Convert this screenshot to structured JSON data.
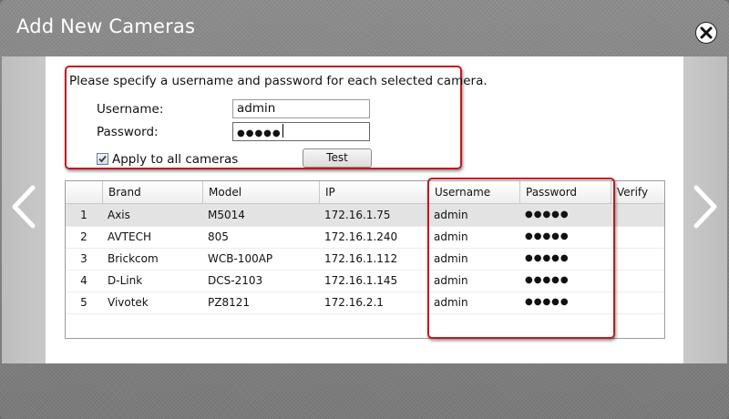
{
  "dialog": {
    "title": "Add New Cameras",
    "close_icon": "close-circle-icon",
    "prev_icon": "chevron-left-icon",
    "next_icon": "chevron-right-icon"
  },
  "credentials": {
    "instructions": "Please specify a username and password for each selected camera.",
    "username_label": "Username:",
    "username_value": "admin",
    "password_label": "Password:",
    "password_value": "●●●●●",
    "apply_all_label": "Apply to all cameras",
    "apply_all_checked": true,
    "test_label": "Test"
  },
  "table": {
    "columns": [
      "",
      "Brand",
      "Model",
      "IP",
      "Username",
      "Password",
      "Verify"
    ],
    "rows": [
      {
        "num": "1",
        "brand": "Axis",
        "model": "M5014",
        "ip": "172.16.1.75",
        "username": "admin",
        "password": "●●●●●",
        "verify": ""
      },
      {
        "num": "2",
        "brand": "AVTECH",
        "model": "805",
        "ip": "172.16.1.240",
        "username": "admin",
        "password": "●●●●●",
        "verify": ""
      },
      {
        "num": "3",
        "brand": "Brickcom",
        "model": "WCB-100AP",
        "ip": "172.16.1.112",
        "username": "admin",
        "password": "●●●●●",
        "verify": ""
      },
      {
        "num": "4",
        "brand": "D-Link",
        "model": "DCS-2103",
        "ip": "172.16.1.145",
        "username": "admin",
        "password": "●●●●●",
        "verify": ""
      },
      {
        "num": "5",
        "brand": "Vivotek",
        "model": "PZ8121",
        "ip": "172.16.2.1",
        "username": "admin",
        "password": "●●●●●",
        "verify": ""
      }
    ],
    "selected_row": 1
  },
  "colors": {
    "highlight": "#c2191f",
    "chrome": "#8a8a8a",
    "selected_row": "#e3e3e3"
  }
}
